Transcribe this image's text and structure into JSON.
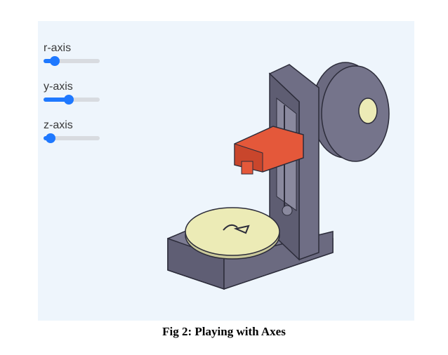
{
  "controls": {
    "r_axis": {
      "label": "r-axis",
      "value": 0.2
    },
    "y_axis": {
      "label": "y-axis",
      "value": 0.45
    },
    "z_axis": {
      "label": "z-axis",
      "value": 0.12
    }
  },
  "caption": "Fig 2: Playing with Axes",
  "colors": {
    "accent": "#1e78ff",
    "printer_body": "#6f6e85",
    "print_head": "#e4583a",
    "bed": "#ecebb6",
    "background": "#eef5fc"
  }
}
